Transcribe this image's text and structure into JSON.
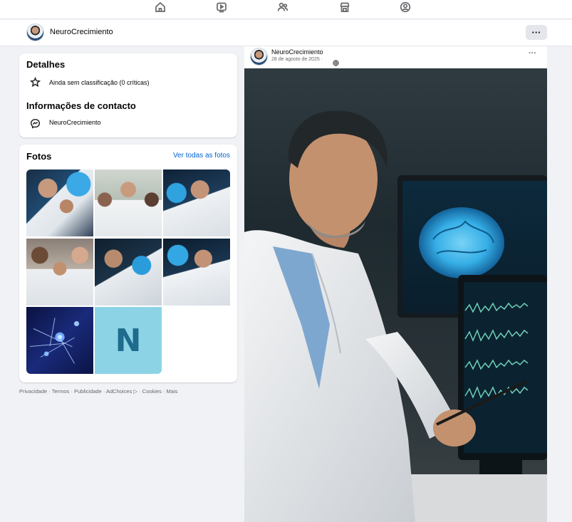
{
  "topnav": {
    "icons": [
      "home-icon",
      "video-icon",
      "friends-icon",
      "marketplace-icon",
      "profile-icon"
    ]
  },
  "profile_bar": {
    "name": "NeuroCrecimiento",
    "more_label": "···"
  },
  "details": {
    "title": "Detalhes",
    "rating": "Ainda sem classificação (0 críticas)",
    "contact_title": "Informações de contacto",
    "messenger": "NeuroCrecimiento"
  },
  "photos": {
    "title": "Fotos",
    "see_all": "Ver todas as fotos",
    "tile_letter": "N"
  },
  "footer": {
    "links": "Privacidade · Termos · Publicidade · AdChoices ▷ · Cookies · Mais"
  },
  "post": {
    "author": "NeuroCrecimiento",
    "date": "28 de agosto de 2025 ·",
    "more_label": "···"
  },
  "colors": {
    "accent_link": "#0064d1",
    "page_bg": "#f0f2f5",
    "card_bg": "#ffffff",
    "tile_n_bg": "#8dd3e6",
    "brain_glow": "#38b6f0"
  }
}
